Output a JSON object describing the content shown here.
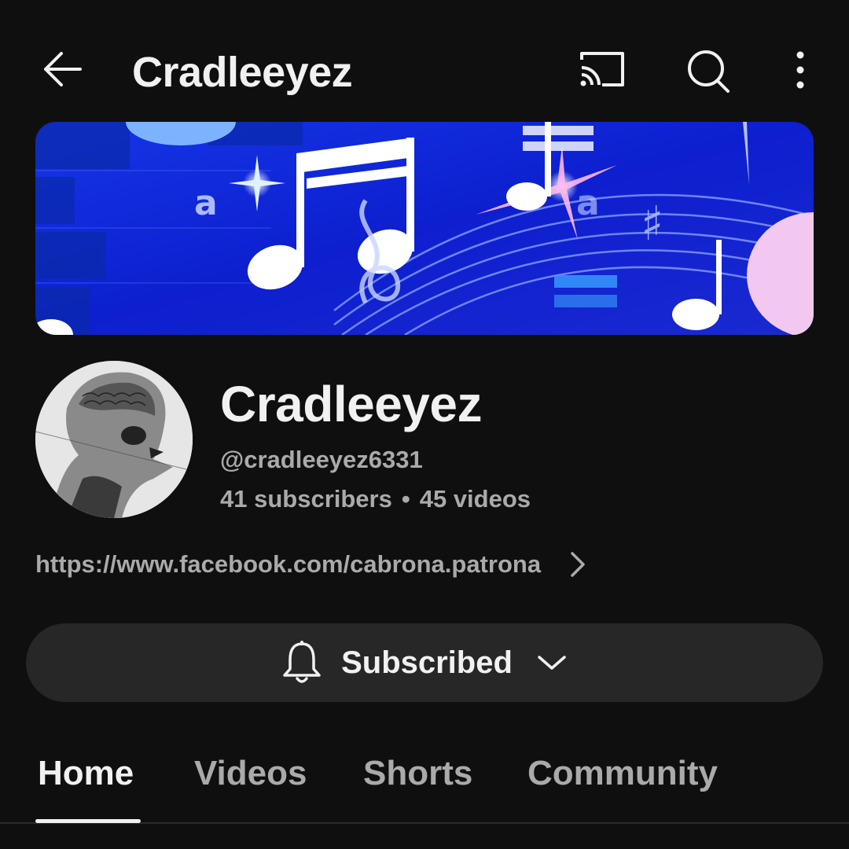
{
  "topbar": {
    "title": "Cradleeyez",
    "back_icon": "arrow-left-icon",
    "cast_icon": "cast-icon",
    "search_icon": "search-icon",
    "more_icon": "more-vertical-icon"
  },
  "channel": {
    "name": "Cradleeyez",
    "handle": "@cradleeyez6331",
    "subscribers": "41 subscribers",
    "separator": "•",
    "videos": "45 videos",
    "link": "https://www.facebook.com/cabrona.patrona"
  },
  "subscribe": {
    "label": "Subscribed",
    "bell_icon": "bell-icon",
    "chevron_icon": "chevron-down-icon"
  },
  "tabs": [
    {
      "label": "Home",
      "active": true
    },
    {
      "label": "Videos",
      "active": false
    },
    {
      "label": "Shorts",
      "active": false
    },
    {
      "label": "Community",
      "active": false
    }
  ],
  "colors": {
    "background": "#0f0f0f",
    "surface": "#272727",
    "text_primary": "#f1f1f1",
    "text_secondary": "#aaaaaa",
    "banner_blue": "#1a2fd6"
  }
}
